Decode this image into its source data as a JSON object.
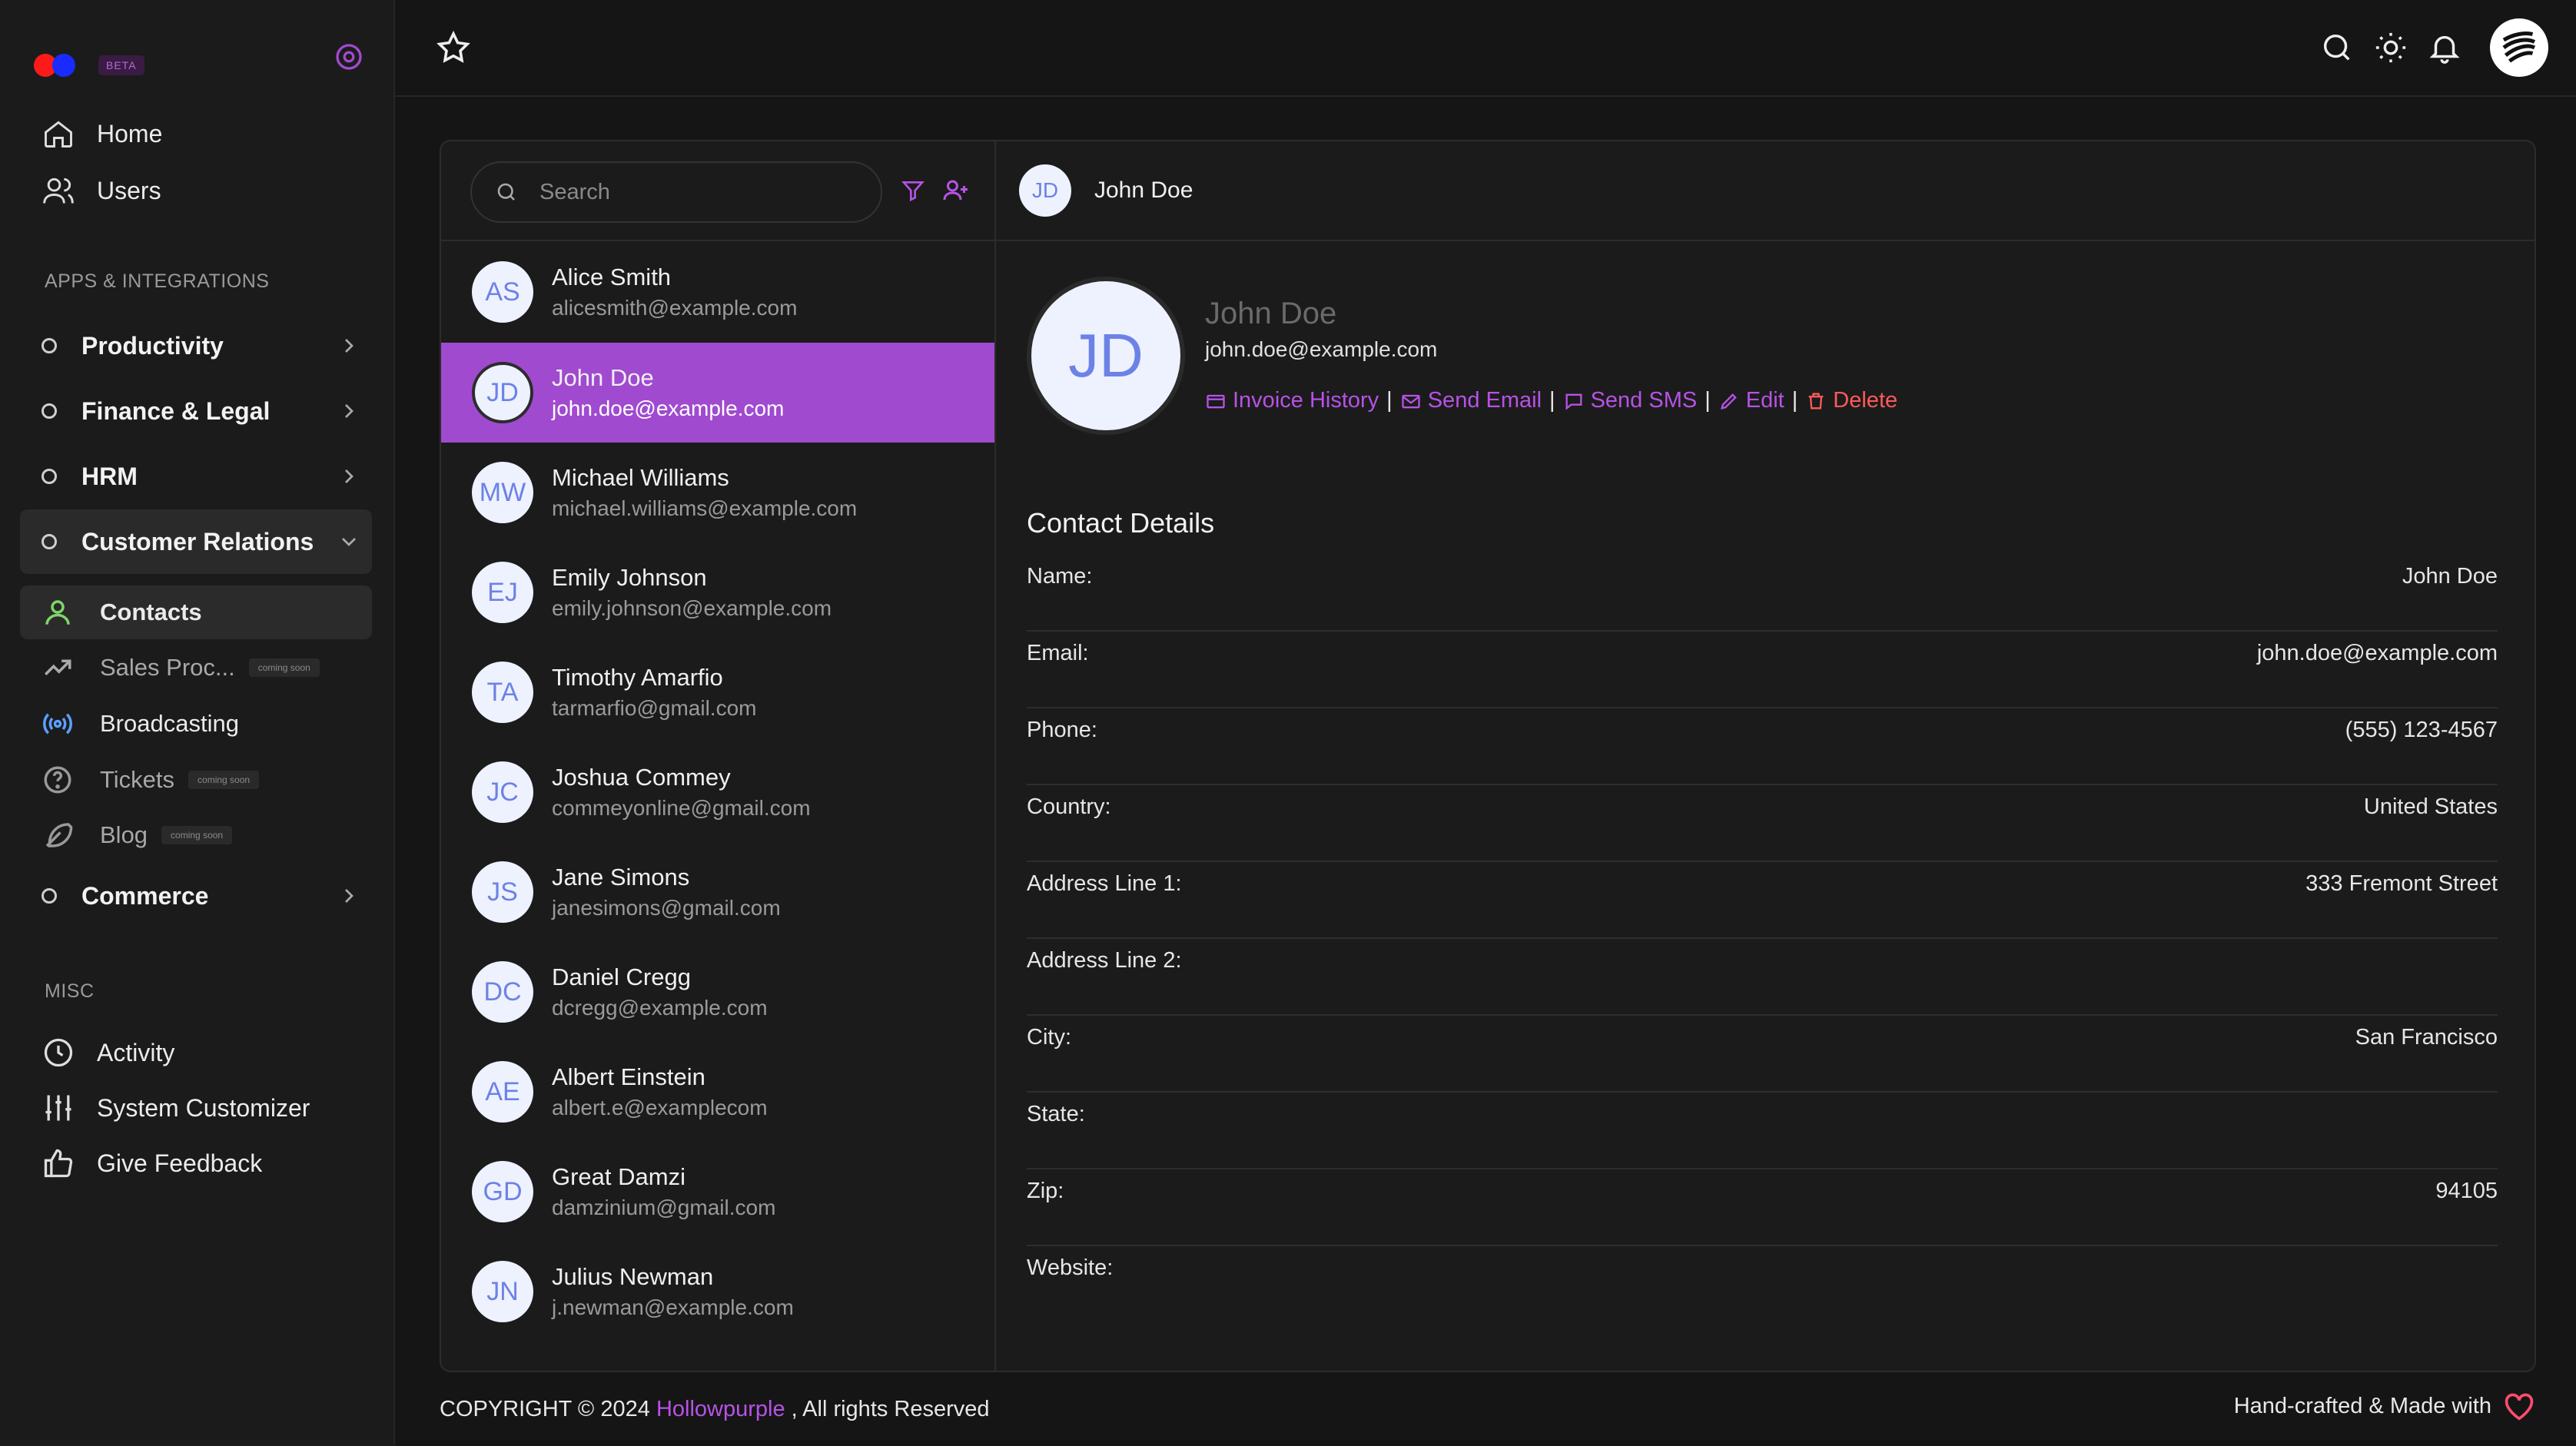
{
  "brand": {
    "badge": "BETA"
  },
  "nav": {
    "home": "Home",
    "users": "Users"
  },
  "sections": {
    "apps": "APPS & INTEGRATIONS",
    "misc": "MISC"
  },
  "groups": {
    "productivity": "Productivity",
    "finance": "Finance & Legal",
    "hrm": "HRM",
    "customer": "Customer Relations",
    "commerce": "Commerce"
  },
  "sub": {
    "contacts": "Contacts",
    "sales": "Sales Proc...",
    "broadcasting": "Broadcasting",
    "tickets": "Tickets",
    "blog": "Blog",
    "coming_soon": "coming soon"
  },
  "misc": {
    "activity": "Activity",
    "customizer": "System Customizer",
    "feedback": "Give Feedback"
  },
  "search": {
    "placeholder": "Search"
  },
  "contacts": [
    {
      "initials": "AS",
      "name": "Alice Smith",
      "email": "alicesmith@example.com"
    },
    {
      "initials": "JD",
      "name": "John Doe",
      "email": "john.doe@example.com"
    },
    {
      "initials": "MW",
      "name": "Michael Williams",
      "email": "michael.williams@example.com"
    },
    {
      "initials": "EJ",
      "name": "Emily Johnson",
      "email": "emily.johnson@example.com"
    },
    {
      "initials": "TA",
      "name": "Timothy Amarfio",
      "email": "tarmarfio@gmail.com"
    },
    {
      "initials": "JC",
      "name": "Joshua Commey",
      "email": "commeyonline@gmail.com"
    },
    {
      "initials": "JS",
      "name": "Jane Simons",
      "email": "janesimons@gmail.com"
    },
    {
      "initials": "DC",
      "name": "Daniel Cregg",
      "email": "dcregg@example.com"
    },
    {
      "initials": "AE",
      "name": "Albert Einstein",
      "email": "albert.e@examplecom"
    },
    {
      "initials": "GD",
      "name": "Great Damzi",
      "email": "damzinium@gmail.com"
    },
    {
      "initials": "JN",
      "name": "Julius Newman",
      "email": "j.newman@example.com"
    }
  ],
  "detail": {
    "initials": "JD",
    "name": "John Doe",
    "email": "john.doe@example.com",
    "actions": {
      "invoice": "Invoice History",
      "email": "Send Email",
      "sms": "Send SMS",
      "edit": "Edit",
      "delete": "Delete",
      "separator": "|"
    },
    "section_title": "Contact Details",
    "fields": [
      {
        "label": "Name:",
        "value": "John Doe"
      },
      {
        "label": "Email:",
        "value": "john.doe@example.com"
      },
      {
        "label": "Phone:",
        "value": "(555) 123-4567"
      },
      {
        "label": "Country:",
        "value": "United States"
      },
      {
        "label": "Address Line 1:",
        "value": "333 Fremont Street"
      },
      {
        "label": "Address Line 2:",
        "value": ""
      },
      {
        "label": "City:",
        "value": "San Francisco"
      },
      {
        "label": "State:",
        "value": ""
      },
      {
        "label": "Zip:",
        "value": "94105"
      },
      {
        "label": "Website:",
        "value": ""
      }
    ]
  },
  "footer": {
    "copyright": "COPYRIGHT © 2024",
    "brand": "Hollowpurple",
    "rights": ", All rights Reserved",
    "made": "Hand-crafted & Made with"
  },
  "colors": {
    "accent": "#a04ad0",
    "link": "#b752e6",
    "danger": "#ff5a5a",
    "active_icon": "#7fd66b",
    "broadcast_icon": "#5aa0ff"
  }
}
